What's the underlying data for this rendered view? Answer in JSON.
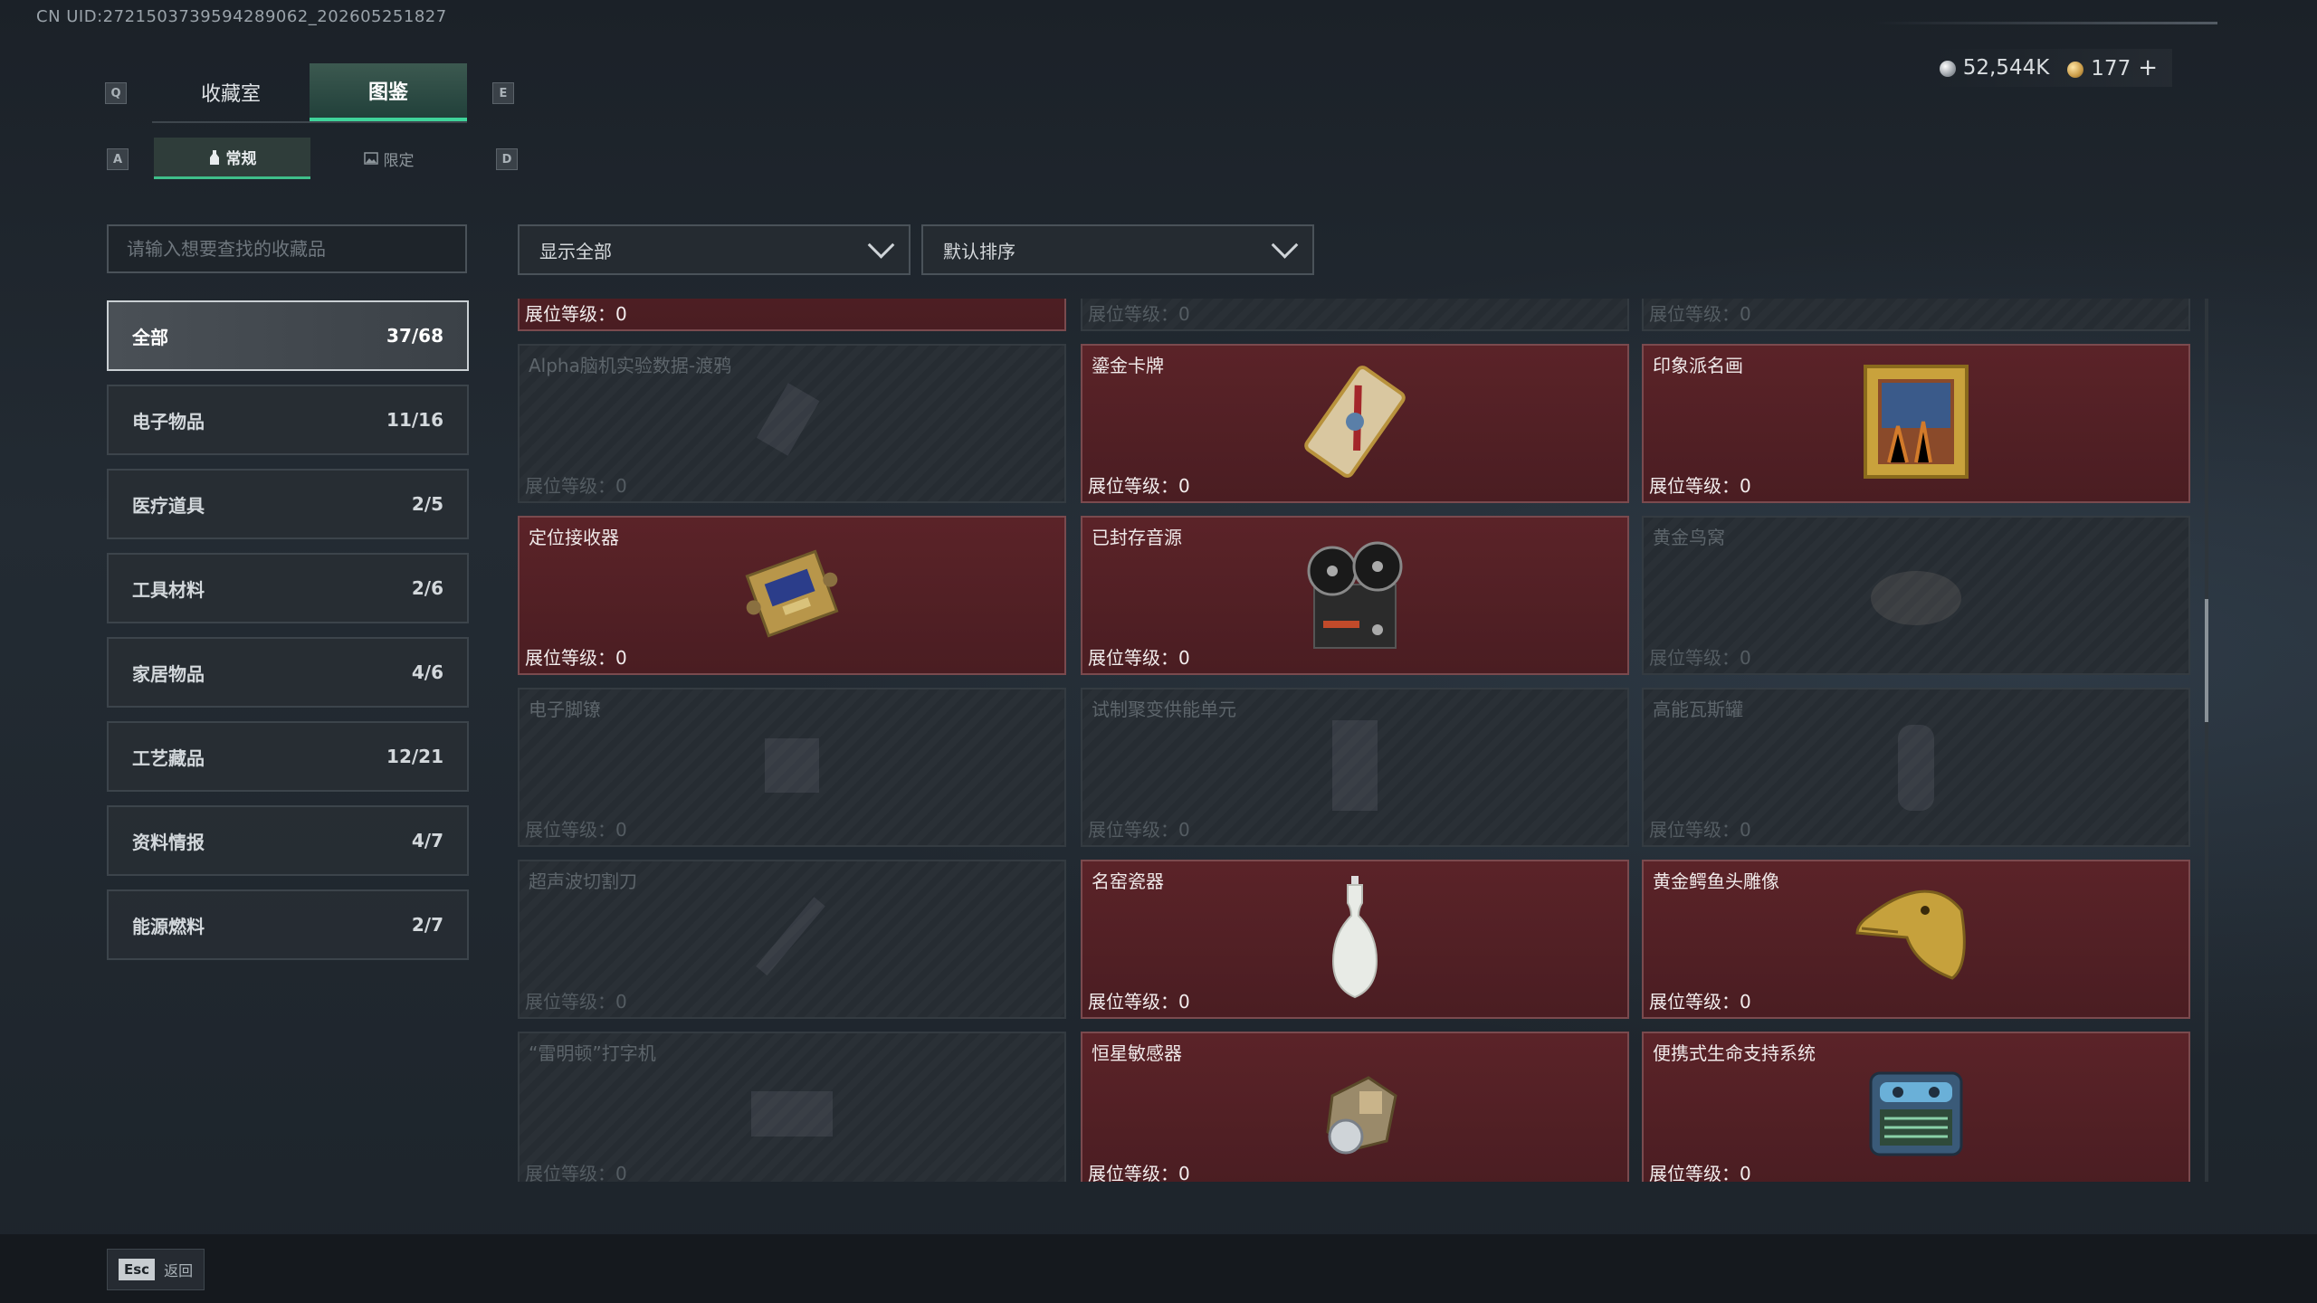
{
  "uid": "CN UID:272150373959428906​2_202605251827",
  "currency": {
    "silver": "52,544K",
    "gold": "177",
    "plus": "+"
  },
  "keys": {
    "q": "Q",
    "e": "E",
    "a": "A",
    "d": "D"
  },
  "main_tabs": [
    {
      "label": "收藏室"
    },
    {
      "label": "图鉴"
    }
  ],
  "sub_tabs": [
    {
      "label": "常规"
    },
    {
      "label": "限定"
    }
  ],
  "search": {
    "placeholder": "请输入想要查找的收藏品"
  },
  "filter": {
    "selected": "显示全部"
  },
  "sort": {
    "selected": "默认排序"
  },
  "categories": [
    {
      "name": "全部",
      "count": "37/68"
    },
    {
      "name": "电子物品",
      "count": "11/16"
    },
    {
      "name": "医疗道具",
      "count": "2/5"
    },
    {
      "name": "工具材料",
      "count": "2/6"
    },
    {
      "name": "家居物品",
      "count": "4/6"
    },
    {
      "name": "工艺藏品",
      "count": "12/21"
    },
    {
      "name": "资料情报",
      "count": "4/7"
    },
    {
      "name": "能源燃料",
      "count": "2/7"
    }
  ],
  "level_label": "展位等级：0",
  "items": [
    {
      "name": "",
      "owned": true,
      "icon": "caviar-tin-icon"
    },
    {
      "name": "",
      "owned": false,
      "icon": "locked-item-icon"
    },
    {
      "name": "",
      "owned": false,
      "icon": "locked-item-icon"
    },
    {
      "name": "Alpha脑机实验数据-渡鸦",
      "owned": false,
      "icon": "data-drive-icon"
    },
    {
      "name": "鎏金卡牌",
      "owned": true,
      "icon": "gilded-card-icon"
    },
    {
      "name": "印象派名画",
      "owned": true,
      "icon": "painting-icon"
    },
    {
      "name": "定位接收器",
      "owned": true,
      "icon": "receiver-icon"
    },
    {
      "name": "已封存音源",
      "owned": true,
      "icon": "reel-recorder-icon"
    },
    {
      "name": "黄金鸟窝",
      "owned": false,
      "icon": "golden-nest-icon"
    },
    {
      "name": "电子脚镣",
      "owned": false,
      "icon": "ankle-monitor-icon"
    },
    {
      "name": "试制聚变供能单元",
      "owned": false,
      "icon": "fusion-cell-icon"
    },
    {
      "name": "高能瓦斯罐",
      "owned": false,
      "icon": "gas-canister-icon"
    },
    {
      "name": "超声波切割刀",
      "owned": false,
      "icon": "ultrasonic-knife-icon"
    },
    {
      "name": "名窑瓷器",
      "owned": true,
      "icon": "porcelain-vase-icon"
    },
    {
      "name": "黄金鳄鱼头雕像",
      "owned": true,
      "icon": "croc-statue-icon"
    },
    {
      "name": "“雷明顿”打字机",
      "owned": false,
      "icon": "typewriter-icon"
    },
    {
      "name": "恒星敏感器",
      "owned": true,
      "icon": "star-sensor-icon"
    },
    {
      "name": "便携式生命支持系统",
      "owned": true,
      "icon": "life-support-icon"
    }
  ],
  "footer": {
    "esc_key": "Esc",
    "back_label": "返回"
  }
}
